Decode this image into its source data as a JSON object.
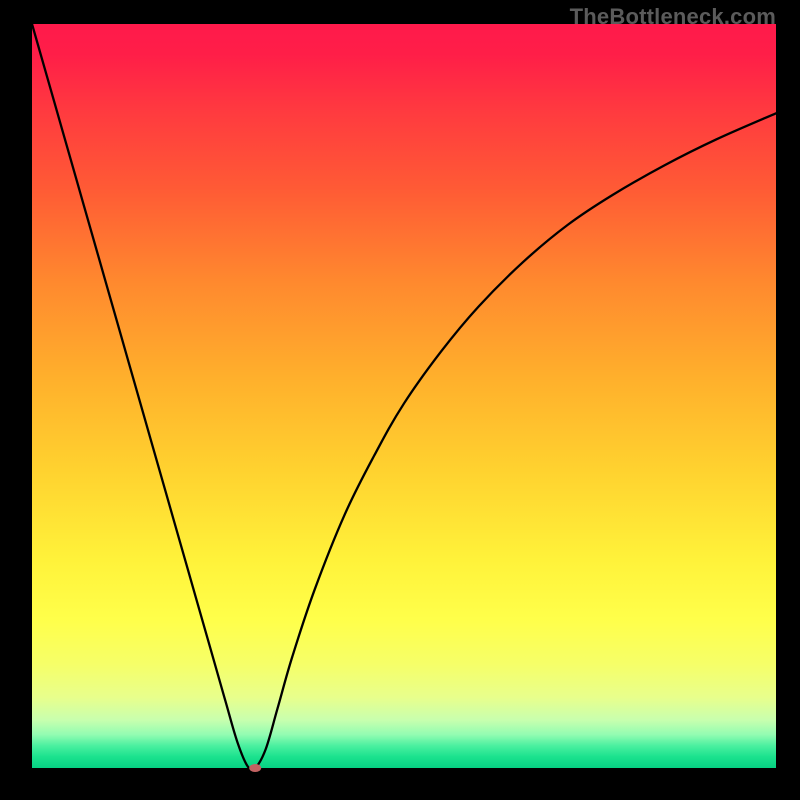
{
  "watermark": "TheBottleneck.com",
  "chart_data": {
    "type": "line",
    "title": "",
    "xlabel": "",
    "ylabel": "",
    "xlim": [
      0,
      100
    ],
    "ylim": [
      0,
      100
    ],
    "grid": false,
    "legend": null,
    "gradient_stops": [
      {
        "offset": 0.0,
        "color": "#ff1a4b"
      },
      {
        "offset": 0.04,
        "color": "#ff1e48"
      },
      {
        "offset": 0.12,
        "color": "#ff3b3f"
      },
      {
        "offset": 0.22,
        "color": "#ff5a35"
      },
      {
        "offset": 0.35,
        "color": "#ff8a2e"
      },
      {
        "offset": 0.48,
        "color": "#ffb12c"
      },
      {
        "offset": 0.6,
        "color": "#ffd22f"
      },
      {
        "offset": 0.72,
        "color": "#fff23a"
      },
      {
        "offset": 0.8,
        "color": "#ffff4a"
      },
      {
        "offset": 0.86,
        "color": "#f6ff68"
      },
      {
        "offset": 0.905,
        "color": "#e8ff8c"
      },
      {
        "offset": 0.935,
        "color": "#c9ffae"
      },
      {
        "offset": 0.955,
        "color": "#93fcb2"
      },
      {
        "offset": 0.97,
        "color": "#4bf0a0"
      },
      {
        "offset": 0.985,
        "color": "#1be28e"
      },
      {
        "offset": 1.0,
        "color": "#06d183"
      }
    ],
    "series": [
      {
        "name": "bottleneck-curve",
        "x": [
          0,
          2,
          4,
          6,
          8,
          10,
          12,
          14,
          16,
          18,
          20,
          22,
          24,
          26,
          27.6,
          29,
          30,
          31.4,
          33,
          35,
          38,
          42,
          46,
          50,
          55,
          60,
          66,
          72,
          78,
          85,
          92,
          100
        ],
        "y": [
          100,
          93,
          86,
          79,
          72,
          65,
          58,
          51,
          44,
          37,
          30,
          23,
          16,
          9,
          3.5,
          0.2,
          0,
          2.5,
          8,
          15,
          24,
          34,
          42,
          49,
          56,
          62,
          68,
          73,
          77,
          81,
          84.5,
          88
        ]
      }
    ],
    "marker": {
      "x": 30,
      "y": 0,
      "color": "#c26262",
      "rx": 6,
      "ry": 4
    }
  }
}
